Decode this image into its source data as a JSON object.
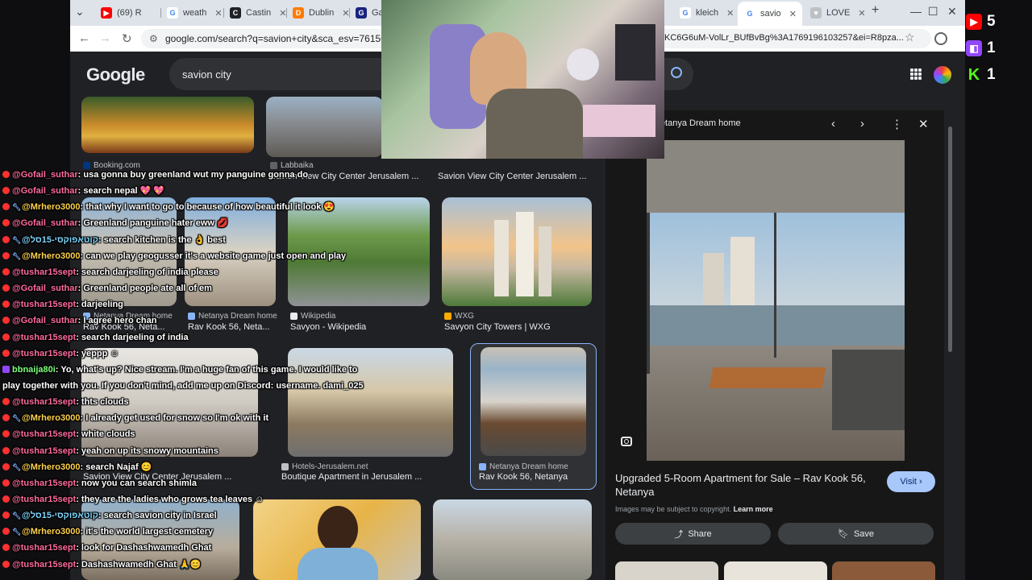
{
  "browser": {
    "tabs": [
      {
        "label": "(69) R",
        "icon": "youtube-icon",
        "color": "#ff0000"
      },
      {
        "label": "weath",
        "icon": "google-icon",
        "color": "#4285f4"
      },
      {
        "label": "Castin",
        "icon": "casting-icon",
        "color": "#202124"
      },
      {
        "label": "Dublin",
        "icon": "dublin-icon",
        "color": "#ff7a00"
      },
      {
        "label": "Ga",
        "icon": "ga-icon",
        "color": "#1a237e"
      },
      {
        "label": "kleich",
        "icon": "google-icon",
        "color": "#4285f4"
      },
      {
        "label": "savio",
        "icon": "google-icon",
        "color": "#4285f4"
      },
      {
        "label": "LOVE",
        "icon": "love-icon",
        "color": "#9aa0a6"
      }
    ],
    "new_tab": "+",
    "window_controls": [
      "—",
      "☐",
      "✕"
    ],
    "tab_list": "⌄",
    "url_left": "google.com/search?q=savion+city&sca_esv=76156e36",
    "url_right": "KC6G6uM-VolLr_BUfBvBg%3A1769196103257&ei=R8pza..."
  },
  "google": {
    "logo": "Google",
    "query": "savion city",
    "results": [
      {
        "source": "Booking.com",
        "title": "",
        "src_color": "#003580"
      },
      {
        "source": "Labbaika",
        "title": "Savion View City Center Jerusalem ...",
        "src_color": "#444"
      },
      {
        "source": "",
        "title": "Savion View City Center Jerusalem ...",
        "src_color": "#444"
      },
      {
        "source": "Netanya Dream home",
        "title": "Rav Kook 56, Neta...",
        "src_color": "#8ab4f8"
      },
      {
        "source": "Netanya Dream home",
        "title": "Rav Kook 56, Neta...",
        "src_color": "#8ab4f8"
      },
      {
        "source": "Wikipedia",
        "title": "Savyon - Wikipedia",
        "src_color": "#e8eaed"
      },
      {
        "source": "WXG",
        "title": "Savyon City Towers | WXG",
        "src_color": "#f9ab00"
      },
      {
        "source": "",
        "title": "Savion View City Center Jerusalem ...",
        "src_color": "#444"
      },
      {
        "source": "Hotels-Jerusalem.net",
        "title": "Boutique Apartment in Jerusalem ...",
        "src_color": "#bdc1c6"
      },
      {
        "source": "Netanya Dream home",
        "title": "Rav Kook 56, Netanya",
        "src_color": "#8ab4f8"
      }
    ],
    "panel": {
      "title": "Netanya Dream home",
      "heading": "Upgraded 5-Room Apartment for Sale – Rav Kook 56, Netanya",
      "visit": "Visit",
      "copyright": "Images may be subject to copyright.",
      "learn_more": "Learn more",
      "share": "Share",
      "save": "Save"
    }
  },
  "chat": [
    {
      "user": "@Gofail_suthar",
      "text": ": usa gonna buy greenland wut my panguine gonna do",
      "color": "#ff6b9d",
      "badge": "youtube"
    },
    {
      "user": "@Gofail_suthar",
      "text": ": search nepal 💖 💖",
      "color": "#ff6b9d",
      "badge": "youtube"
    },
    {
      "user": "@Mrhero3000",
      "text": ": that why I want to go to because of how beautiful it look 😍",
      "color": "#ffd24a",
      "badge": "youtube-tool"
    },
    {
      "user": "@Gofail_suthar",
      "text": ": Greenland panguine hater eww 💋",
      "color": "#ff6b9d",
      "badge": "youtube"
    },
    {
      "user": "@קוטאפוקסי-15סל",
      "text": ": search kitchen is the 👌 best",
      "color": "#7ed6ff",
      "badge": "youtube-tool"
    },
    {
      "user": "@Mrhero3000",
      "text": ": can we play geogusser it's a website game just open and play",
      "color": "#ffd24a",
      "badge": "youtube-tool"
    },
    {
      "user": "@tushar15sept",
      "text": ": search darjeeling of india please",
      "color": "#ff6b9d",
      "badge": "youtube"
    },
    {
      "user": "@Gofail_suthar",
      "text": ": Greenland people ate all of em",
      "color": "#ff6b9d",
      "badge": "youtube"
    },
    {
      "user": "@tushar15sept",
      "text": ": darjeeling",
      "color": "#ff6b9d",
      "badge": "youtube"
    },
    {
      "user": "@Gofail_suthar",
      "text": ": I agree hero chan",
      "color": "#ff6b9d",
      "badge": "youtube"
    },
    {
      "user": "@tushar15sept",
      "text": ": search darjeeling of india",
      "color": "#ff6b9d",
      "badge": "youtube"
    },
    {
      "user": "@tushar15sept",
      "text": ": yeppp ☺",
      "color": "#ff6b9d",
      "badge": "youtube"
    },
    {
      "user": "bbnaija80i",
      "text": ": Yo, what's up? Nice stream. I'm a huge fan of this game. I would like to",
      "color": "#7dff7d",
      "badge": "twitch"
    },
    {
      "user": "",
      "text": "play together with you. If you don't mind, add me up on Discord: username. dami_025",
      "color": "#ffffff",
      "badge": "none"
    },
    {
      "user": "@tushar15sept",
      "text": ": thts clouds",
      "color": "#ff6b9d",
      "badge": "youtube"
    },
    {
      "user": "@Mrhero3000",
      "text": ": I already get used for snow so I'm ok with it",
      "color": "#ffd24a",
      "badge": "youtube-tool"
    },
    {
      "user": "@tushar15sept",
      "text": ": white clouds",
      "color": "#ff6b9d",
      "badge": "youtube"
    },
    {
      "user": "@tushar15sept",
      "text": ": yeah on up its snowy mountains",
      "color": "#ff6b9d",
      "badge": "youtube"
    },
    {
      "user": "@Mrhero3000",
      "text": ": search Najaf 😊",
      "color": "#ffd24a",
      "badge": "youtube-tool"
    },
    {
      "user": "@tushar15sept",
      "text": ": now you can search shimla",
      "color": "#ff6b9d",
      "badge": "youtube"
    },
    {
      "user": "@tushar15sept",
      "text": ": they are the ladies who grows tea leaves ☺",
      "color": "#ff6b9d",
      "badge": "youtube"
    },
    {
      "user": "@קוטאפוקסי-15סל",
      "text": ": search savion city in Israel",
      "color": "#7ed6ff",
      "badge": "youtube-tool"
    },
    {
      "user": "@Mrhero3000",
      "text": ": it's the world largest cemetery",
      "color": "#ffd24a",
      "badge": "youtube-tool"
    },
    {
      "user": "@tushar15sept",
      "text": ": look for Dashashwamedh Ghat",
      "color": "#ff6b9d",
      "badge": "youtube"
    },
    {
      "user": "@tushar15sept",
      "text": ": Dashashwamedh Ghat 🙏😊",
      "color": "#ff6b9d",
      "badge": "youtube"
    }
  ],
  "viewers": [
    {
      "platform": "youtube",
      "count": "5",
      "color": "#ff0000",
      "glyph": "▶"
    },
    {
      "platform": "twitch",
      "count": "1",
      "color": "#9146ff",
      "glyph": "◧"
    },
    {
      "platform": "kick",
      "count": "1",
      "color": "#53fc18",
      "glyph": "K"
    }
  ]
}
